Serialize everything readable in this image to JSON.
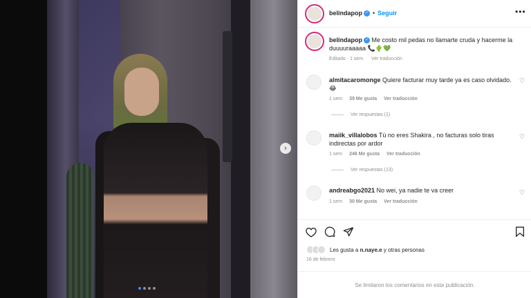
{
  "post": {
    "username": "belindapop",
    "follow_label": "Seguir",
    "more_icon": "more-dots-icon",
    "caption_text": "Me costo mil pedas no llamarte cruda y hacerme la duuuuraaaaa 📞🌵💚",
    "caption_meta": {
      "edited": "Editado · 1 sem",
      "translate": "Ver traducción"
    }
  },
  "comments": [
    {
      "username": "almitacaromonge",
      "text": "Quiere facturar muy tarde ya es caso olvidado. 😂",
      "time": "1 sem",
      "likes": "39 Me gusta",
      "translate": "Ver traducción",
      "replies": "Ver respuestas (1)"
    },
    {
      "username": "maiik_villalobos",
      "text": "Tú no eres Shakira , no facturas solo tiras indirectas por ardor",
      "time": "1 sem",
      "likes": "246 Me gusta",
      "translate": "Ver traducción",
      "replies": "Ver respuestas (13)"
    },
    {
      "username": "andreabgo2021",
      "text": "No wei, ya nadie te va creer",
      "time": "1 sem",
      "likes": "30 Me gusta",
      "translate": "Ver traducción",
      "replies": ""
    }
  ],
  "likes": {
    "prefix": "Les gusta a ",
    "user": "n.naye.e",
    "suffix": " y otras personas"
  },
  "date": "16 de febrero",
  "footer": "Se limitaron los comentarios en esta publicación.",
  "carousel": {
    "count": 4,
    "active_index": 0
  },
  "colors": {
    "accent": "#0095f6",
    "verified": "#3897f0",
    "story_ring": "#d62976"
  }
}
